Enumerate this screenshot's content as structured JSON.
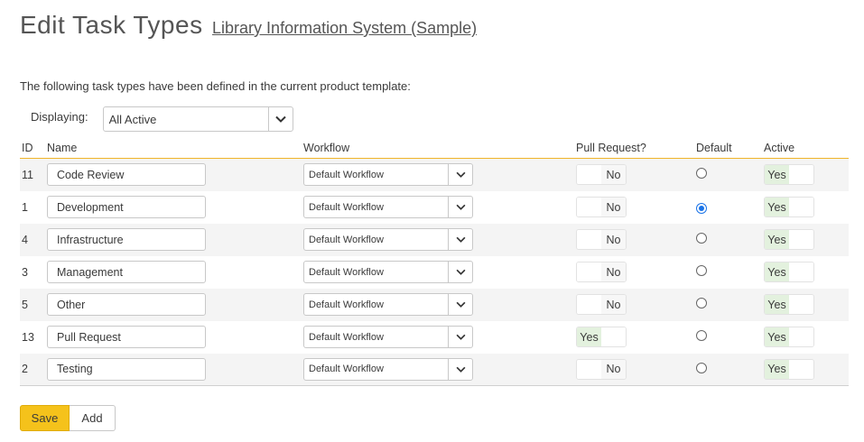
{
  "header": {
    "title": "Edit Task Types",
    "project": "Library Information System (Sample)"
  },
  "intro": "The following task types have been defined in the current product template:",
  "filter": {
    "label": "Displaying:",
    "value": "All Active"
  },
  "table": {
    "columns": [
      "ID",
      "Name",
      "Workflow",
      "Pull Request?",
      "Default",
      "Active"
    ],
    "rows": [
      {
        "id": "11",
        "name": "Code Review",
        "workflow": "Default Workflow",
        "pull_request": "No",
        "default": false,
        "active": "Yes"
      },
      {
        "id": "1",
        "name": "Development",
        "workflow": "Default Workflow",
        "pull_request": "No",
        "default": true,
        "active": "Yes"
      },
      {
        "id": "4",
        "name": "Infrastructure",
        "workflow": "Default Workflow",
        "pull_request": "No",
        "default": false,
        "active": "Yes"
      },
      {
        "id": "3",
        "name": "Management",
        "workflow": "Default Workflow",
        "pull_request": "No",
        "default": false,
        "active": "Yes"
      },
      {
        "id": "5",
        "name": "Other",
        "workflow": "Default Workflow",
        "pull_request": "No",
        "default": false,
        "active": "Yes"
      },
      {
        "id": "13",
        "name": "Pull Request",
        "workflow": "Default Workflow",
        "pull_request": "Yes",
        "default": false,
        "active": "Yes"
      },
      {
        "id": "2",
        "name": "Testing",
        "workflow": "Default Workflow",
        "pull_request": "No",
        "default": false,
        "active": "Yes"
      }
    ]
  },
  "buttons": {
    "save": "Save",
    "add": "Add"
  },
  "icons": {
    "dropdown": "chevron-down-icon"
  },
  "colors": {
    "accent": "#f5c21b",
    "header_border": "#f0b429",
    "toggle_on": "#e3f1de",
    "radio_checked": "#1a73e8"
  }
}
